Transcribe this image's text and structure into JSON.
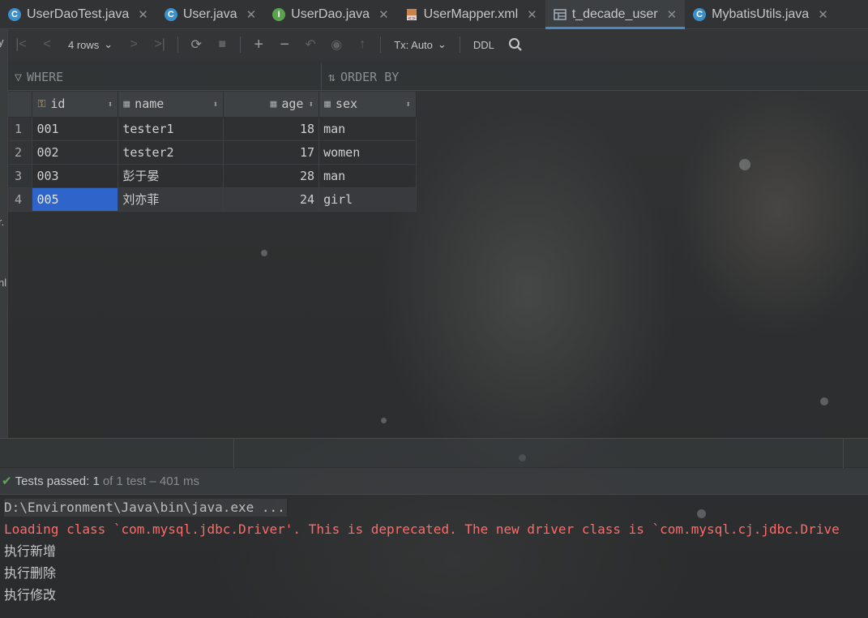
{
  "tabs": [
    {
      "label": "UserDaoTest.java",
      "icon": "class-icon"
    },
    {
      "label": "User.java",
      "icon": "class-icon"
    },
    {
      "label": "UserDao.java",
      "icon": "interface-icon"
    },
    {
      "label": "UserMapper.xml",
      "icon": "xml-icon"
    },
    {
      "label": "t_decade_user",
      "icon": "table-icon",
      "active": true
    },
    {
      "label": "MybatisUtils.java",
      "icon": "class-icon"
    }
  ],
  "toolbar": {
    "rows_label": "4 rows",
    "tx_label": "Tx: Auto",
    "ddl_label": "DDL"
  },
  "filter": {
    "where_label": "WHERE",
    "orderby_label": "ORDER BY"
  },
  "table": {
    "columns": [
      "id",
      "name",
      "age",
      "sex"
    ],
    "rows": [
      {
        "n": "1",
        "id": "001",
        "name": "tester1",
        "age": "18",
        "sex": "man"
      },
      {
        "n": "2",
        "id": "002",
        "name": "tester2",
        "age": "17",
        "sex": "women"
      },
      {
        "n": "3",
        "id": "003",
        "name": "彭于晏",
        "age": "28",
        "sex": "man"
      },
      {
        "n": "4",
        "id": "005",
        "name": "刘亦菲",
        "age": "24",
        "sex": "girl"
      }
    ]
  },
  "test_status": {
    "passed_label": "Tests passed:",
    "passed_count": "1",
    "detail": "of 1 test – 401 ms"
  },
  "console": {
    "cmd": "D:\\Environment\\Java\\bin\\java.exe ...",
    "warning": "Loading class `com.mysql.jdbc.Driver'. This is deprecated. The new driver class is `com.mysql.cj.jdbc.Drive",
    "outputs": [
      "执行新增",
      "执行删除",
      "执行修改"
    ]
  },
  "colors": {
    "accent": "#4a88c7",
    "selection": "#2f65ca",
    "error": "#ff6b68",
    "success": "#5fa85b"
  }
}
